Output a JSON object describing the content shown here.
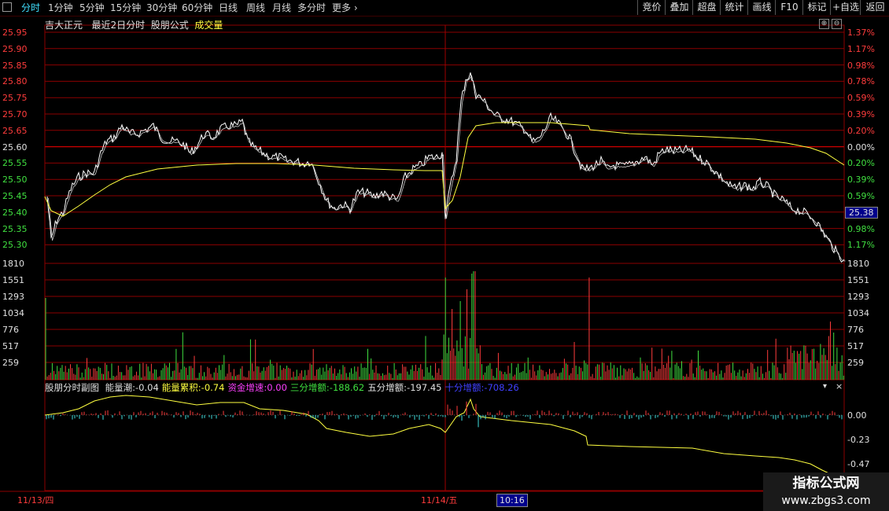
{
  "toolbar": {
    "tabs": [
      "分时",
      "1分钟",
      "5分钟",
      "15分钟",
      "30分钟",
      "60分钟",
      "日线",
      "周线",
      "月线",
      "多分时",
      "更多"
    ],
    "more_arrow": "›",
    "right_buttons": [
      "竞价",
      "叠加",
      "超盘",
      "统计",
      "画线",
      "F10",
      "标记",
      "+自选",
      "返回"
    ]
  },
  "stock": {
    "name": "吉大正元",
    "period": "最近2日分时",
    "formula": "股朋公式",
    "indicator": "成交量"
  },
  "price_axis": {
    "left": [
      "25.95",
      "25.90",
      "25.85",
      "25.80",
      "25.75",
      "25.70",
      "25.65",
      "25.60",
      "25.55",
      "25.50",
      "25.45",
      "25.40",
      "25.35",
      "25.30"
    ],
    "right": [
      "1.37%",
      "1.17%",
      "0.98%",
      "0.78%",
      "0.59%",
      "0.39%",
      "0.20%",
      "0.00%",
      "0.20%",
      "0.39%",
      "0.59%",
      "0.78%",
      "0.98%",
      "1.17%"
    ],
    "current_price": "25.38"
  },
  "volume_axis": [
    "1810",
    "1551",
    "1293",
    "1034",
    "776",
    "517",
    "259"
  ],
  "sub_chart": {
    "title": "股朋分时副图",
    "items": [
      {
        "label": "能量潮:",
        "value": "-0.04",
        "color": "#e0e0e0"
      },
      {
        "label": "能量累积:",
        "value": "-0.74",
        "color": "#ffff40"
      },
      {
        "label": "资金增速:",
        "value": "0.00",
        "color": "#ff40ff"
      },
      {
        "label": "三分增额:",
        "value": "-188.62",
        "color": "#40e040"
      },
      {
        "label": "五分增额:",
        "value": "-197.45",
        "color": "#e0e0e0"
      },
      {
        "label": "十分增额:",
        "value": "-708.26",
        "color": "#4040ff"
      }
    ],
    "axis": [
      "0.00",
      "-0.23",
      "-0.47"
    ],
    "collapse_icon": "▾",
    "close_icon": "×"
  },
  "time_axis": {
    "day1": "11/13/四",
    "day2": "11/14/五",
    "cursor_time": "10:16"
  },
  "watermark": {
    "line1": "指标公式网",
    "line2": "www.zbgs3.com"
  },
  "colors": {
    "up": "#ff3c3c",
    "down": "#40e040",
    "grid": "#8b0000",
    "price_line": "#ffffff",
    "avg_line": "#ffff40"
  }
}
